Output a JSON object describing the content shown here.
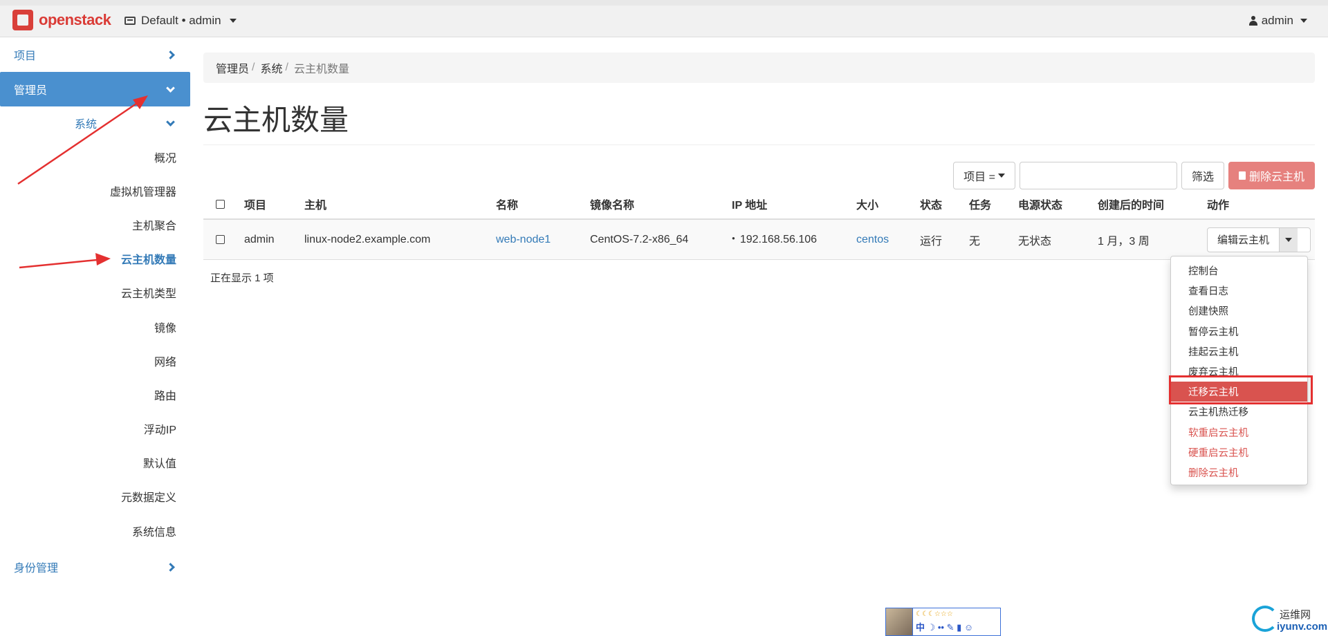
{
  "topbar": {
    "brand": "openstack",
    "project_switch": "Default • admin",
    "user": "admin"
  },
  "sidebar": {
    "project": "项目",
    "admin": "管理员",
    "system": "系统",
    "items": [
      {
        "label": "概况"
      },
      {
        "label": "虚拟机管理器"
      },
      {
        "label": "主机聚合"
      },
      {
        "label": "云主机数量"
      },
      {
        "label": "云主机类型"
      },
      {
        "label": "镜像"
      },
      {
        "label": "网络"
      },
      {
        "label": "路由"
      },
      {
        "label": "浮动IP"
      },
      {
        "label": "默认值"
      },
      {
        "label": "元数据定义"
      },
      {
        "label": "系统信息"
      }
    ],
    "active_item": "云主机数量",
    "identity": "身份管理"
  },
  "breadcrumb": {
    "crumbs": [
      "管理员",
      "系统"
    ],
    "current": "云主机数量"
  },
  "page_title": "云主机数量",
  "filter": {
    "field_label": "项目 =",
    "input_value": "",
    "filter_button": "筛选",
    "delete_button": "删除云主机"
  },
  "table": {
    "headers": [
      "项目",
      "主机",
      "名称",
      "镜像名称",
      "IP 地址",
      "大小",
      "状态",
      "任务",
      "电源状态",
      "创建后的时间",
      "动作"
    ],
    "rows": [
      {
        "project": "admin",
        "host": "linux-node2.example.com",
        "name": "web-node1",
        "image": "CentOS-7.2-x86_64",
        "ip": "192.168.56.106",
        "size": "centos",
        "status": "运行",
        "task": "无",
        "power": "无状态",
        "created": "1 月，3 周",
        "action": "编辑云主机"
      }
    ],
    "count_text": "正在显示 1 项"
  },
  "dropdown": {
    "items": [
      {
        "label": "控制台",
        "style": "normal"
      },
      {
        "label": "查看日志",
        "style": "normal"
      },
      {
        "label": "创建快照",
        "style": "normal"
      },
      {
        "label": "暂停云主机",
        "style": "normal"
      },
      {
        "label": "挂起云主机",
        "style": "normal"
      },
      {
        "label": "废弃云主机",
        "style": "normal"
      },
      {
        "label": "迁移云主机",
        "style": "highlight"
      },
      {
        "label": "云主机热迁移",
        "style": "normal"
      },
      {
        "label": "软重启云主机",
        "style": "danger"
      },
      {
        "label": "硬重启云主机",
        "style": "danger"
      },
      {
        "label": "删除云主机",
        "style": "danger"
      }
    ]
  },
  "watermark": {
    "toolbar_icons": "中 ☽ •• ✎ ▮ ☺",
    "site_name": "运维网",
    "site_url": "iyunv.com"
  },
  "colors": {
    "brand_red": "#da3b36",
    "link_blue": "#337ab7",
    "active_nav_bg": "#4a90cf",
    "danger": "#d9534f",
    "annotation_red": "#e43030"
  }
}
